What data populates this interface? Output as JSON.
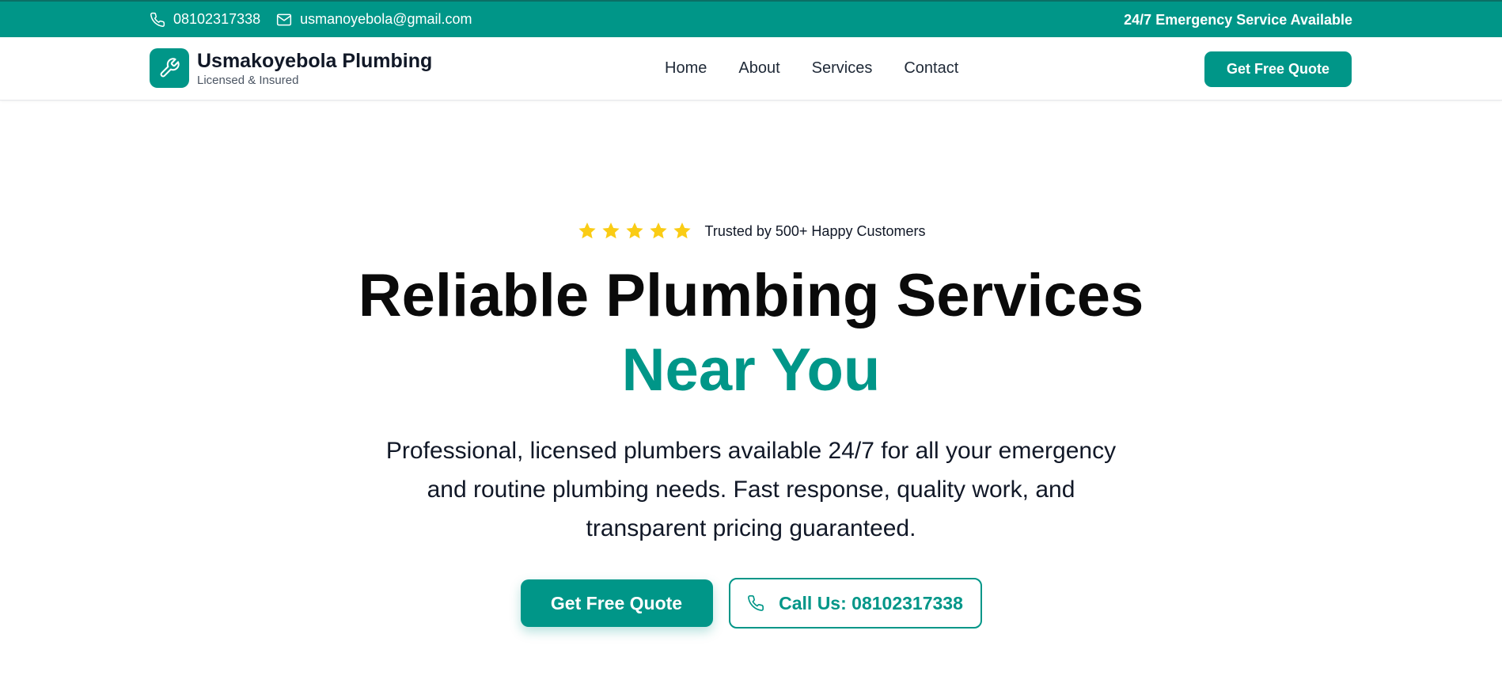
{
  "topbar": {
    "phone": "08102317338",
    "email": "usmanoyebola@gmail.com",
    "emergency": "24/7 Emergency Service Available",
    "color": "#009688"
  },
  "brand": {
    "name": "Usmakoyebola Plumbing",
    "tagline": "Licensed & Insured",
    "icon": "wrench-icon"
  },
  "nav": {
    "items": [
      {
        "label": "Home"
      },
      {
        "label": "About"
      },
      {
        "label": "Services"
      },
      {
        "label": "Contact"
      }
    ],
    "cta": "Get Free Quote"
  },
  "hero": {
    "rating_stars": 5,
    "rating_text": "Trusted by 500+ Happy Customers",
    "headline_line1": "Reliable Plumbing Services",
    "headline_line2": "Near You",
    "description": "Professional, licensed plumbers available 24/7 for all your emergency and routine plumbing needs. Fast response, quality work, and transparent pricing guaranteed.",
    "primary_button": "Get Free Quote",
    "secondary_button": "Call Us: 08102317338"
  },
  "colors": {
    "accent": "#009688",
    "star": "#facc15"
  }
}
